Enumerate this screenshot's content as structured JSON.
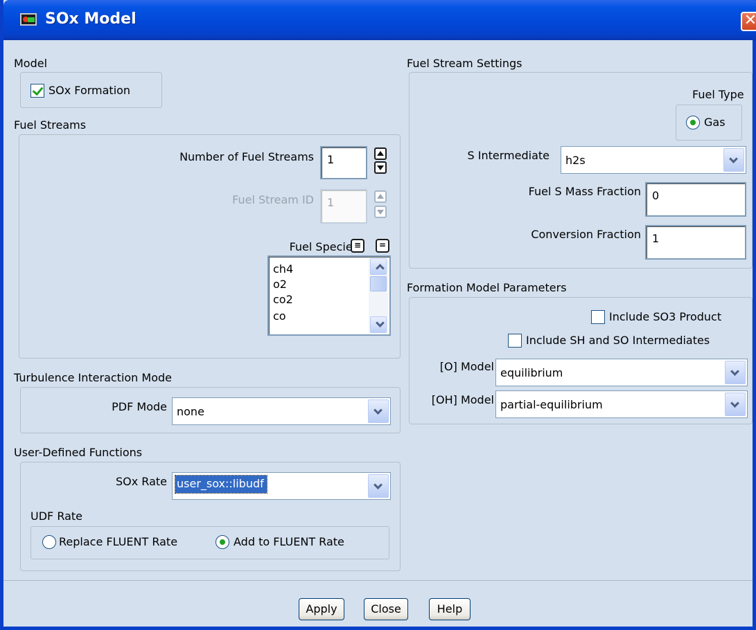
{
  "window": {
    "title": "SOx Model"
  },
  "model": {
    "label": "Model",
    "sox_formation": {
      "label": "SOx Formation",
      "checked": true
    }
  },
  "fuel_streams": {
    "label": "Fuel Streams",
    "number_label": "Number of Fuel Streams",
    "number_value": "1",
    "id_label": "Fuel Stream ID",
    "id_value": "1",
    "species_label": "Fuel Species",
    "species": [
      "ch4",
      "o2",
      "co2",
      "co"
    ]
  },
  "turbulence": {
    "label": "Turbulence Interaction Mode",
    "pdf_label": "PDF Mode",
    "pdf_value": "none"
  },
  "udf": {
    "label": "User-Defined Functions",
    "sox_rate_label": "SOx Rate",
    "sox_rate_value": "user_sox::libudf",
    "udf_rate_label": "UDF Rate",
    "replace_label": "Replace FLUENT Rate",
    "add_label": "Add to FLUENT Rate",
    "selected": "add"
  },
  "fuel_stream_settings": {
    "label": "Fuel Stream Settings",
    "fuel_type_label": "Fuel Type",
    "gas_label": "Gas",
    "s_intermediate_label": "S Intermediate",
    "s_intermediate_value": "h2s",
    "fuel_s_mass_label": "Fuel S Mass Fraction",
    "fuel_s_mass_value": "0",
    "conversion_label": "Conversion Fraction",
    "conversion_value": "1"
  },
  "formation": {
    "label": "Formation Model Parameters",
    "include_so3_label": "Include SO3 Product",
    "include_so3": false,
    "include_sh_label": "Include SH and SO Intermediates",
    "include_sh": false,
    "o_model_label": "[O] Model",
    "o_model_value": "equilibrium",
    "oh_model_label": "[OH] Model",
    "oh_model_value": "partial-equilibrium"
  },
  "buttons": {
    "apply": "Apply",
    "close": "Close",
    "help": "Help"
  }
}
